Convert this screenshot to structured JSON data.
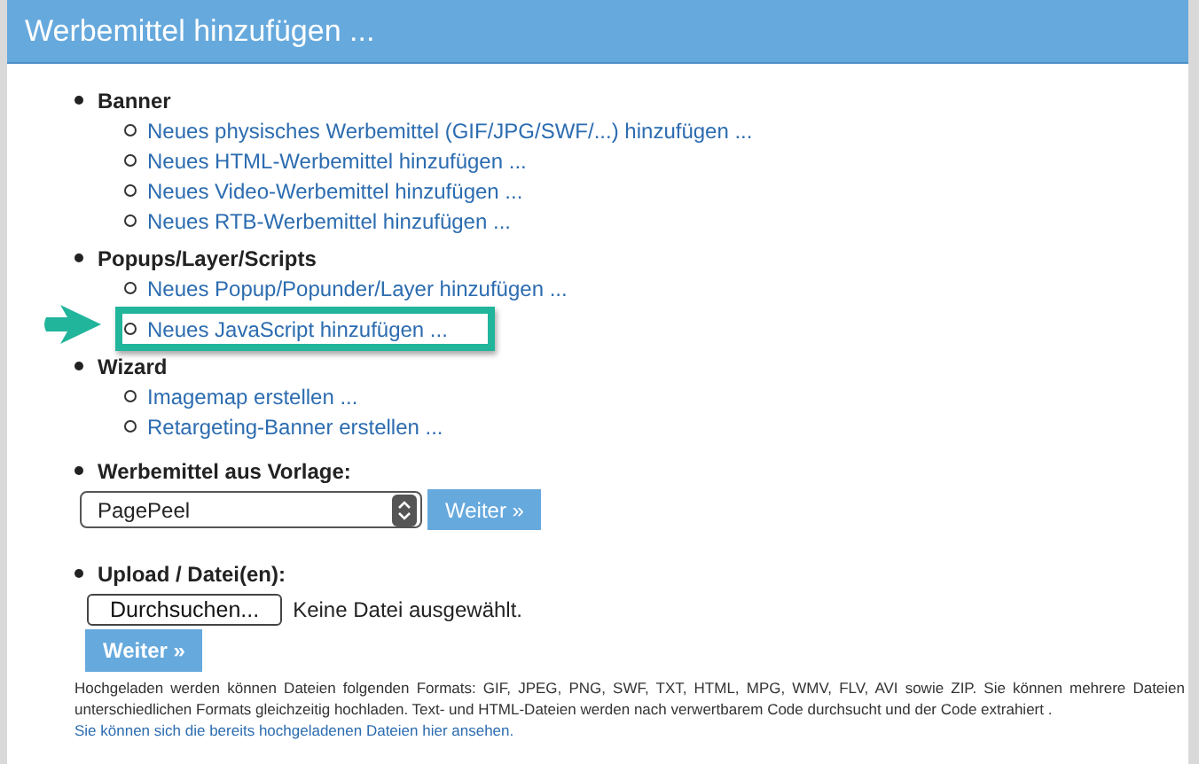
{
  "header": {
    "title": "Werbemittel hinzufügen ..."
  },
  "sections": [
    {
      "kind": "links",
      "title": "Banner",
      "links": [
        {
          "text": "Neues physisches Werbemittel (GIF/JPG/SWF/...) hinzufügen ...",
          "highlighted": false
        },
        {
          "text": "Neues HTML-Werbemittel hinzufügen ...",
          "highlighted": false
        },
        {
          "text": "Neues Video-Werbemittel hinzufügen ...",
          "highlighted": false
        },
        {
          "text": "Neues RTB-Werbemittel hinzufügen ...",
          "highlighted": false
        }
      ]
    },
    {
      "kind": "links",
      "title": "Popups/Layer/Scripts",
      "links": [
        {
          "text": "Neues Popup/Popunder/Layer hinzufügen ...",
          "highlighted": false
        },
        {
          "text": "Neues JavaScript hinzufügen ...",
          "highlighted": true
        }
      ]
    },
    {
      "kind": "links",
      "title": "Wizard",
      "links": [
        {
          "text": "Imagemap erstellen ...",
          "highlighted": false
        },
        {
          "text": "Retargeting-Banner erstellen ...",
          "highlighted": false
        }
      ]
    },
    {
      "kind": "select",
      "title": "Werbemittel aus Vorlage:",
      "value": "PagePeel",
      "button": "Weiter »"
    },
    {
      "kind": "upload",
      "title": "Upload / Datei(en):",
      "browse": "Durchsuchen...",
      "status": "Keine Datei ausgewählt.",
      "button": "Weiter »"
    }
  ],
  "note": {
    "text": "Hochgeladen werden können Dateien folgenden Formats: GIF, JPEG, PNG, SWF, TXT, HTML, MPG, WMV, FLV, AVI sowie ZIP. Sie können mehrere Dateien unterschiedlichen Formats gleichzeitig hochladen. Text- und HTML-Dateien werden nach verwertbarem Code durchsucht und der Code extrahiert .",
    "link": "Sie können sich die bereits hochgeladenen Dateien hier ansehen."
  }
}
